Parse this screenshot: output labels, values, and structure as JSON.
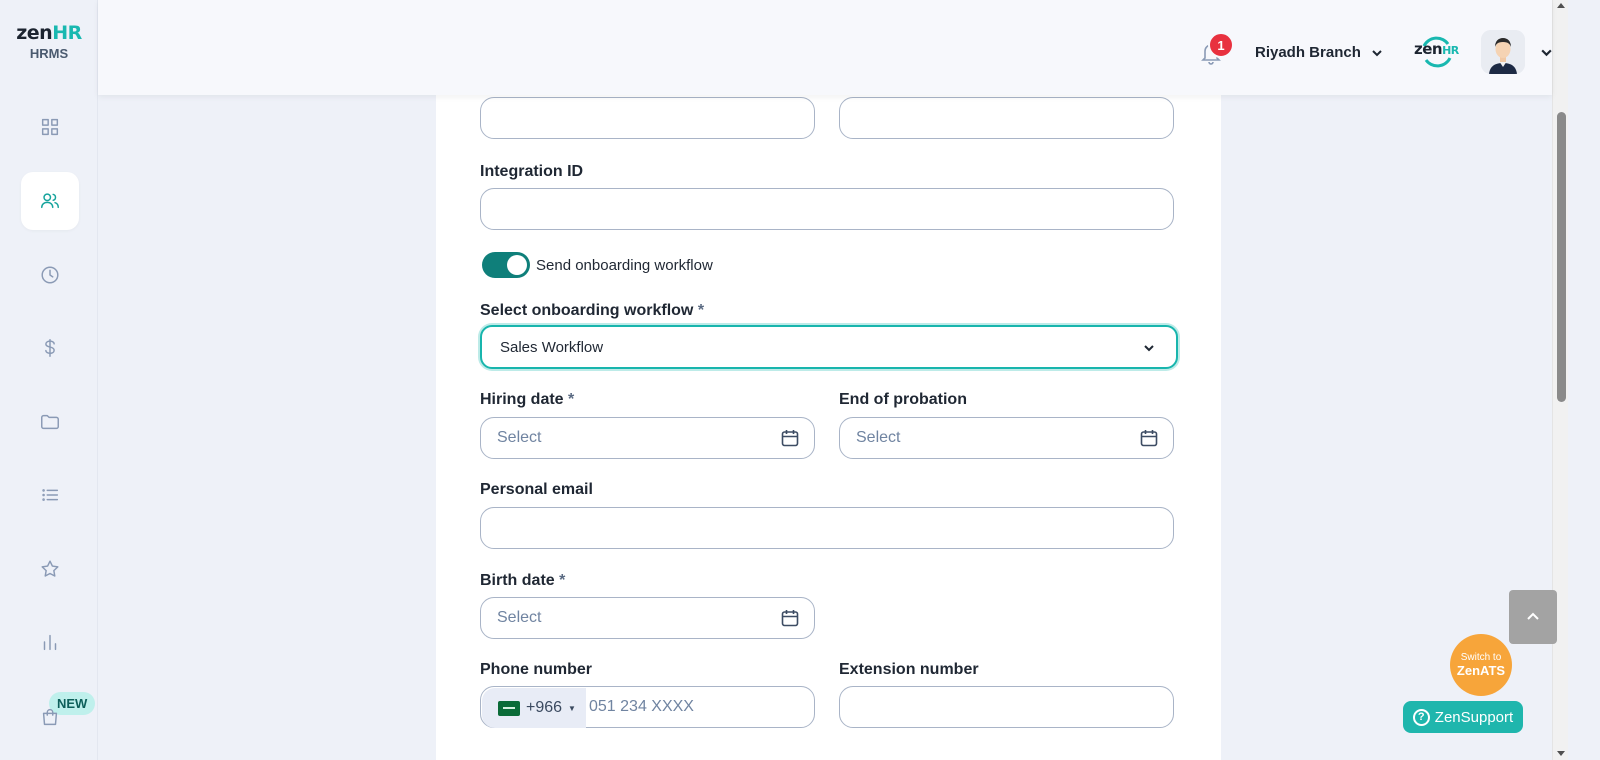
{
  "app": {
    "brand_main": "zen",
    "brand_accent": "HR",
    "brand_sub": "HRMS",
    "accent_color": "#19b8b0"
  },
  "sidebar": {
    "items": [
      {
        "name": "dashboard",
        "icon": "grid-icon"
      },
      {
        "name": "employees",
        "icon": "users-icon",
        "active": true
      },
      {
        "name": "attendance",
        "icon": "clock-icon"
      },
      {
        "name": "payroll",
        "icon": "dollar-icon"
      },
      {
        "name": "documents",
        "icon": "folder-icon"
      },
      {
        "name": "lists",
        "icon": "list-icon"
      },
      {
        "name": "performance",
        "icon": "star-icon"
      },
      {
        "name": "reports",
        "icon": "bar-chart-icon"
      },
      {
        "name": "marketplace",
        "icon": "bag-icon"
      }
    ],
    "new_badge": "NEW"
  },
  "header": {
    "notification_count": "1",
    "branch": "Riyadh Branch",
    "small_logo_main": "zen",
    "small_logo_accent": "HR"
  },
  "form": {
    "integration_id": {
      "label": "Integration ID",
      "value": ""
    },
    "onboarding_toggle": {
      "label": "Send onboarding workflow",
      "on": true
    },
    "onboarding_workflow": {
      "label": "Select onboarding workflow",
      "required": "*",
      "value": "Sales Workflow"
    },
    "hiring_date": {
      "label": "Hiring date",
      "required": "*",
      "placeholder": "Select"
    },
    "end_of_probation": {
      "label": "End of probation",
      "placeholder": "Select"
    },
    "personal_email": {
      "label": "Personal email",
      "value": ""
    },
    "birth_date": {
      "label": "Birth date",
      "required": "*",
      "placeholder": "Select"
    },
    "phone_number": {
      "label": "Phone number",
      "country_code": "+966",
      "placeholder": "051 234 XXXX"
    },
    "extension_number": {
      "label": "Extension number",
      "value": ""
    }
  },
  "floating": {
    "switch_line1": "Switch to",
    "switch_line2": "ZenATS",
    "support_label": "ZenSupport",
    "support_icon": "?"
  }
}
